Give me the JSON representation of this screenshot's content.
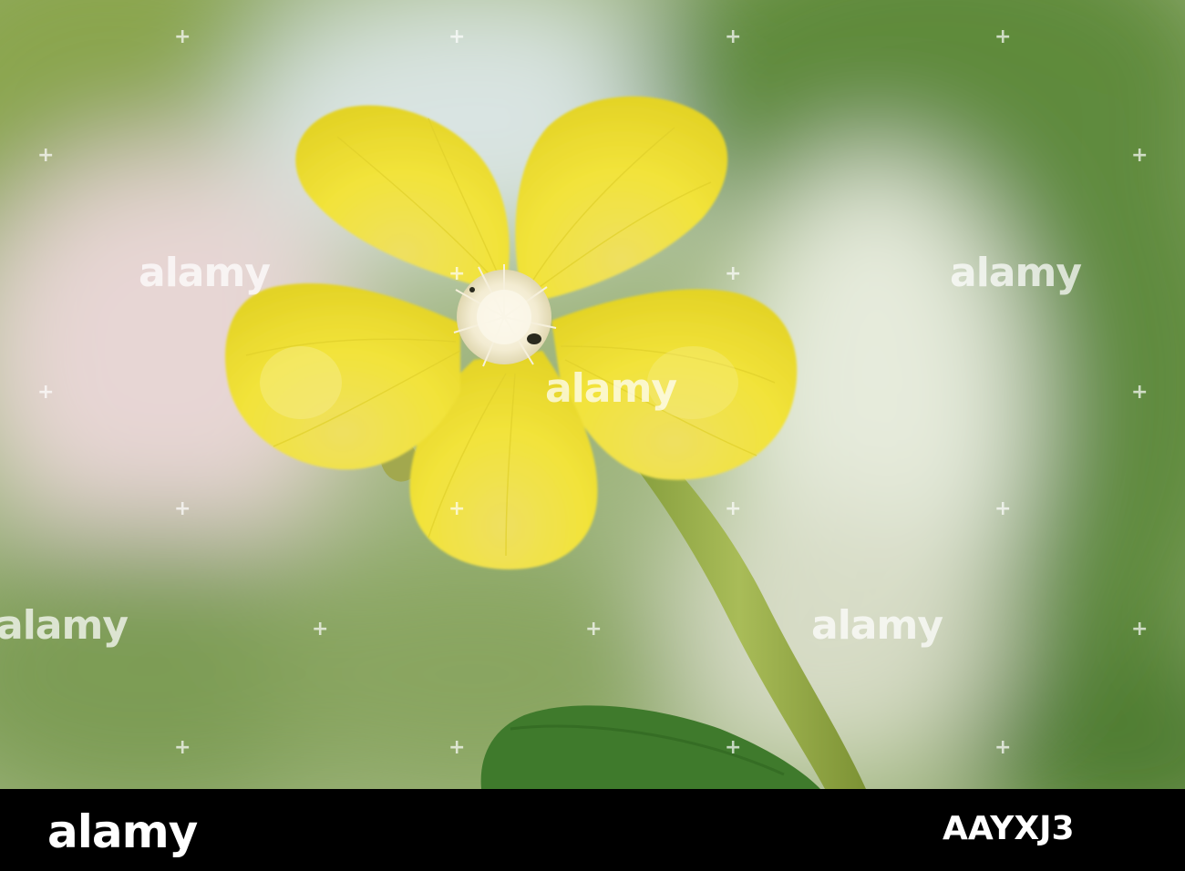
{
  "watermark": {
    "text": "alamy",
    "plus": "+"
  },
  "footer": {
    "logo": "alamy",
    "image_id": "AAYXJ3"
  },
  "colors": {
    "petal": "#f2e33a",
    "petal_shadow": "#d8c820",
    "stamen": "#f4eedc",
    "stem": "#9bb04a",
    "leaf": "#3f7a2c",
    "background": "#a9bd8a",
    "footer": "#000000"
  }
}
